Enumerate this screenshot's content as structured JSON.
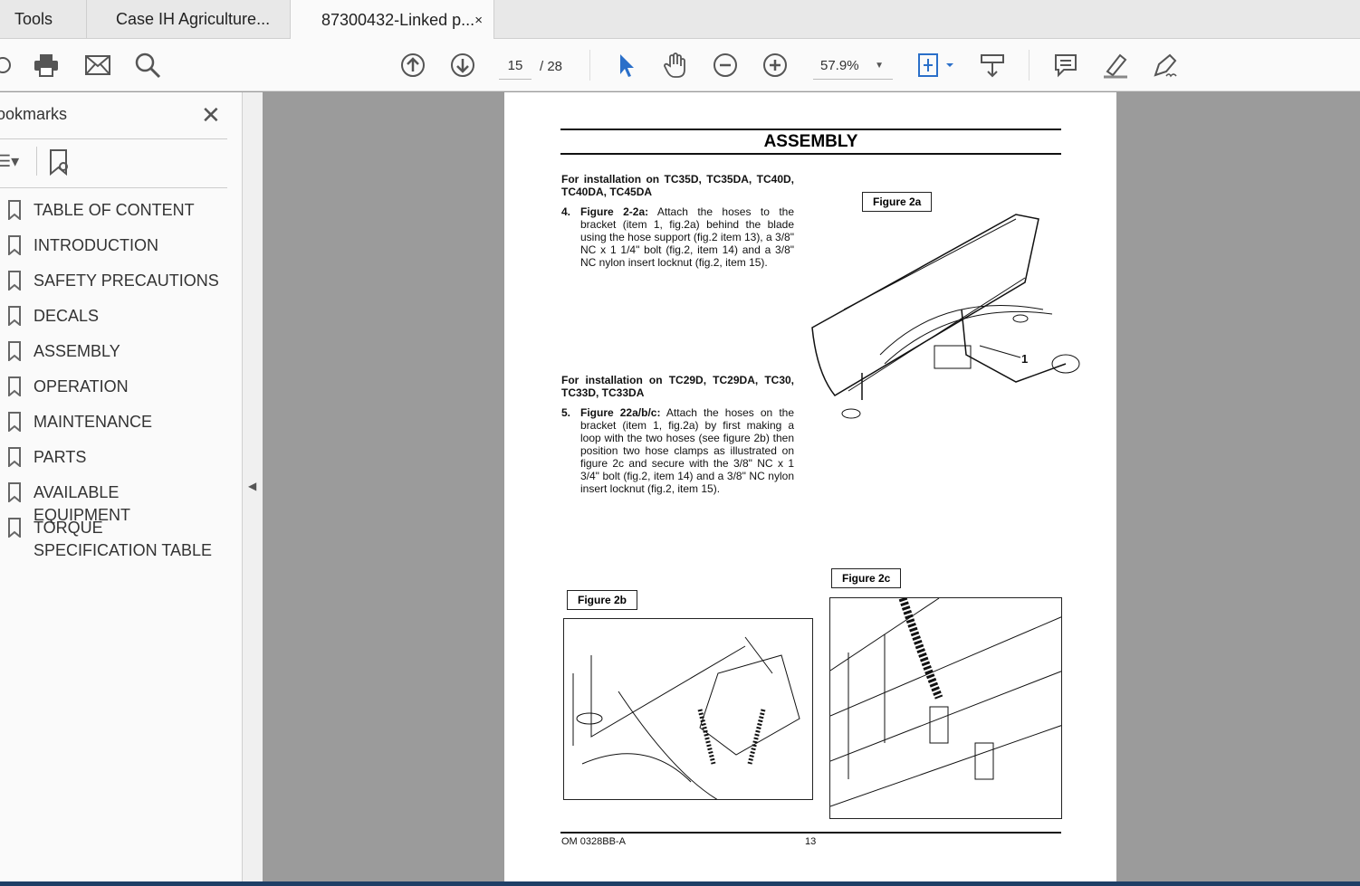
{
  "tabs": [
    {
      "label": "Tools"
    },
    {
      "label": "Case IH Agriculture..."
    },
    {
      "label": "87300432-Linked p..."
    }
  ],
  "toolbar": {
    "page_current": "15",
    "page_total": "/ 28",
    "zoom": "57.9%"
  },
  "sidebar": {
    "title": "ookmarks",
    "items": [
      {
        "label": "TABLE OF CONTENT"
      },
      {
        "label": "INTRODUCTION"
      },
      {
        "label": "SAFETY PRECAUTIONS"
      },
      {
        "label": "DECALS"
      },
      {
        "label": "ASSEMBLY"
      },
      {
        "label": "OPERATION"
      },
      {
        "label": "MAINTENANCE"
      },
      {
        "label": "PARTS"
      },
      {
        "label": "AVAILABLE EQUIPMENT"
      },
      {
        "label": "TORQUE SPECIFICATION TABLE"
      }
    ]
  },
  "document": {
    "heading": "ASSEMBLY",
    "section1_title": "For installation on TC35D, TC35DA, TC40D, TC40DA, TC45DA",
    "step4_num": "4.",
    "step4_lead": "Figure 2-2a:",
    "step4_text": "Attach the hoses to the bracket (item 1, fig.2a) behind the blade using the hose support (fig.2 item 13), a 3/8\" NC x 1 1/4\" bolt (fig.2, item 14) and a 3/8\" NC nylon insert locknut (fig.2, item 15).",
    "section2_title": "For installation on TC29D, TC29DA, TC30, TC33D, TC33DA",
    "step5_num": "5.",
    "step5_lead": "Figure 22a/b/c:",
    "step5_text": "Attach the hoses on the bracket (item 1, fig.2a) by first making a loop with the two hoses (see figure 2b) then position two hose clamps as illustrated on figure 2c and secure with the 3/8\" NC x 1 3/4\" bolt (fig.2, item 14) and a 3/8\" NC nylon insert locknut (fig.2, item 15).",
    "fig2a": "Figure 2a",
    "fig2a_callout": "1",
    "fig2b": "Figure 2b",
    "fig2c": "Figure 2c",
    "footer_left": "OM 0328BB-A",
    "footer_page": "13"
  }
}
